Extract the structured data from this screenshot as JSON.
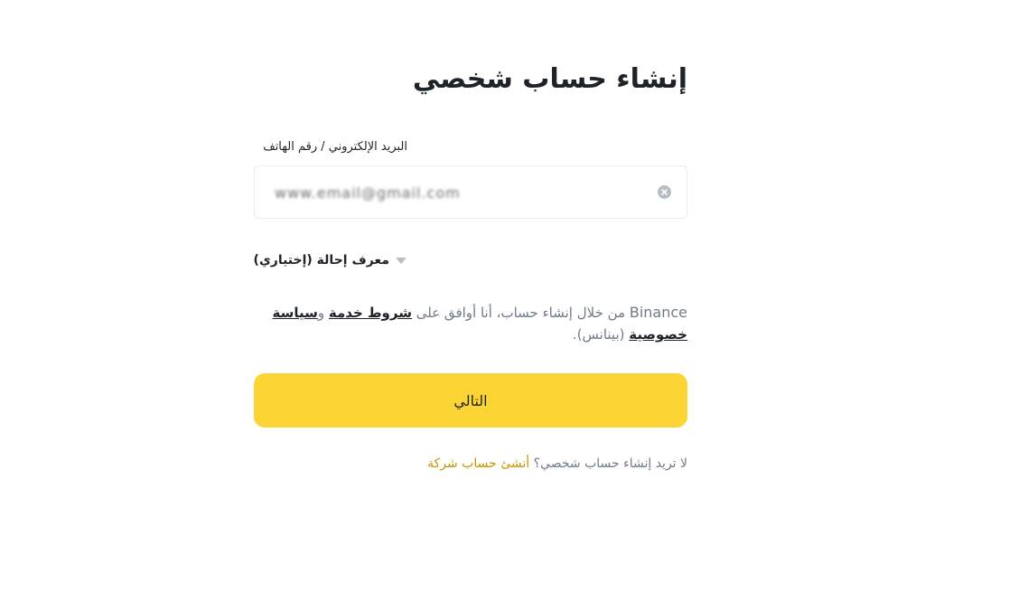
{
  "page": {
    "title": "إنشاء حساب شخصي"
  },
  "form": {
    "field_label": "البريد الإلكتروني / رقم الهاتف",
    "input_value": "www.email@gmail.com",
    "referral_label": "معرف إحالة (إختياري)",
    "terms": {
      "brand": "Binance",
      "prefix": "من خلال إنشاء حساب، أنا أوافق على",
      "terms_link": "شروط خدمة",
      "conjunction": "و",
      "privacy_link": "سياسة خصوصية",
      "suffix": "(بينانس)."
    },
    "next_button": "التالي"
  },
  "footer": {
    "question": "لا تريد إنشاء حساب شخصي؟",
    "link": "أنشئ حساب شركة"
  },
  "colors": {
    "primary": "#fcd535",
    "link": "#c99400",
    "text": "#1e2329",
    "muted": "#707a8a",
    "border": "#eaecef"
  },
  "icons": {
    "clear": "clear-circle-icon",
    "dropdown": "caret-down-icon"
  }
}
